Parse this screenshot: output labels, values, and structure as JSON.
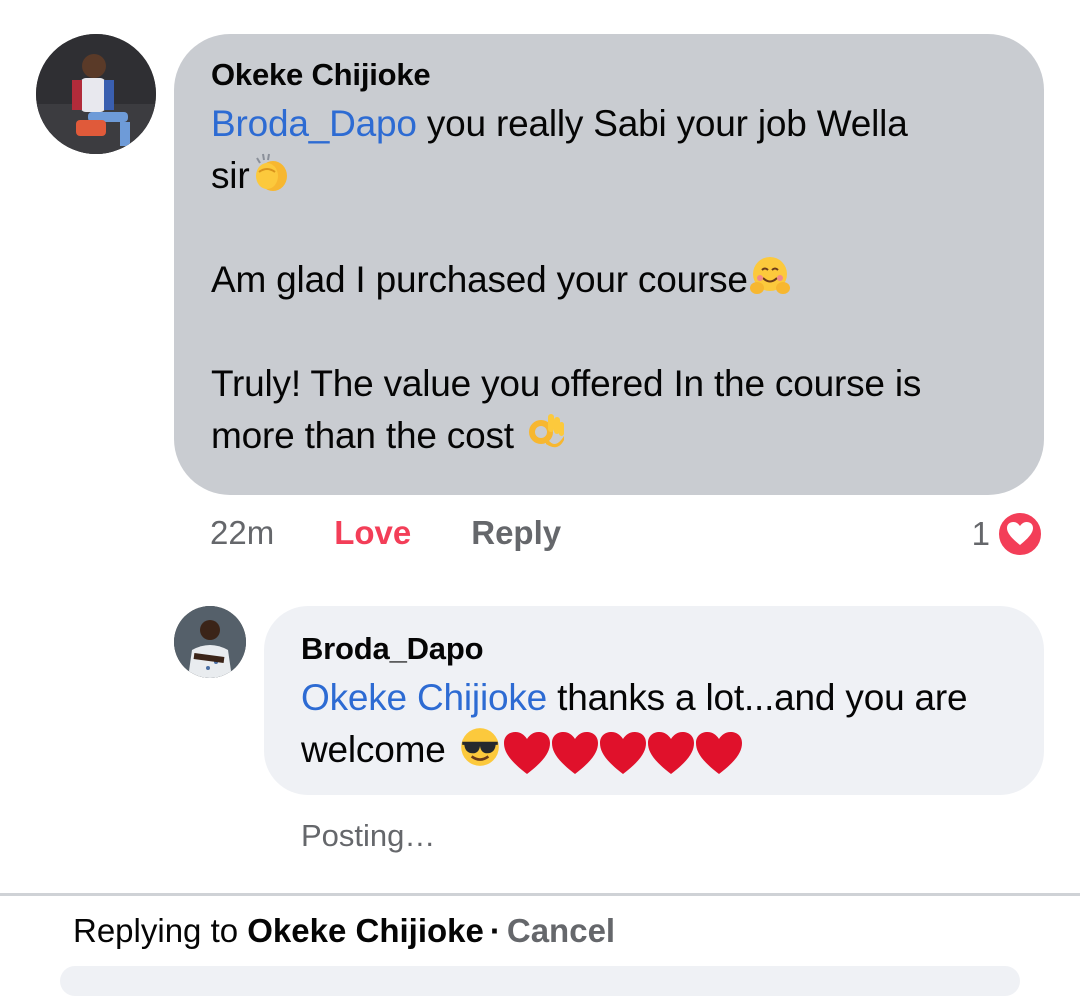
{
  "comment": {
    "author": "Okeke Chijioke",
    "mention": "Broda_Dapo",
    "line1_rest": " you really Sabi your job Wella",
    "line2": "sir",
    "para2": "Am glad I purchased your course",
    "para3": "Truly! The value you offered In the course is more than the cost ",
    "emojis": [
      "clapping-hands",
      "hugging-face",
      "ok-hand"
    ],
    "time": "22m",
    "love_label": "Love",
    "reply_label": "Reply",
    "reaction_count": "1",
    "reaction_type": "love",
    "reaction_color": "#f33e58"
  },
  "reply": {
    "author": "Broda_Dapo",
    "mention": "Okeke Chijioke",
    "text": " thanks a lot...and you are welcome ",
    "emojis": [
      "sunglasses-face",
      "red-heart",
      "red-heart",
      "red-heart",
      "red-heart",
      "red-heart"
    ],
    "status": "Posting…"
  },
  "replying_bar": {
    "prefix": "Replying to ",
    "name": "Okeke Chijioke",
    "separator": "·",
    "cancel": "Cancel"
  },
  "colors": {
    "mention": "#2d6bd3",
    "main_bubble": "#c9ccd1",
    "reply_bubble": "#eff1f5",
    "secondary_text": "#65676b"
  }
}
